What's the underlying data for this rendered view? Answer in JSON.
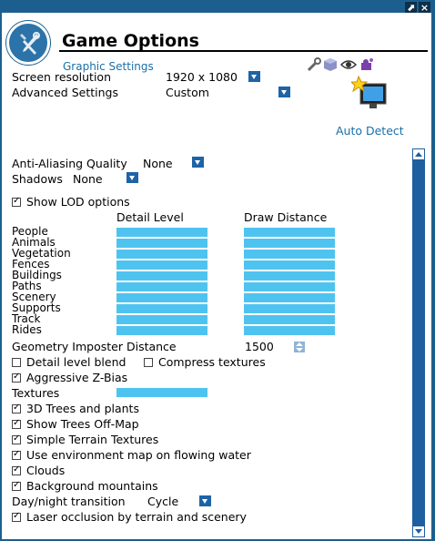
{
  "window": {
    "title": "Game Options",
    "subtitle": "Graphic Settings",
    "colors": {
      "frame": "#1c5f8f",
      "accent": "#1a6fa8",
      "slider": "#4fc3f0",
      "dropdown": "#1e63a6"
    }
  },
  "header_icons": [
    "wrench-icon",
    "cube-icon",
    "eye-icon",
    "puzzle-icon"
  ],
  "resolution": {
    "label": "Screen resolution",
    "value": "1920 x 1080"
  },
  "advanced": {
    "label": "Advanced Settings",
    "value": "Custom"
  },
  "auto_detect": {
    "label": "Auto Detect"
  },
  "antialias": {
    "label": "Anti-Aliasing Quality",
    "value": "None"
  },
  "shadows": {
    "label": "Shadows",
    "value": "None"
  },
  "lod": {
    "show_label": "Show LOD options",
    "show_checked": true,
    "detail_header": "Detail Level",
    "distance_header": "Draw Distance",
    "rows": [
      {
        "label": "People",
        "detail": 1.0,
        "distance": 1.0
      },
      {
        "label": "Animals",
        "detail": 1.0,
        "distance": 1.0
      },
      {
        "label": "Vegetation",
        "detail": 1.0,
        "distance": 1.0
      },
      {
        "label": "Fences",
        "detail": 1.0,
        "distance": 1.0
      },
      {
        "label": "Buildings",
        "detail": 1.0,
        "distance": 1.0
      },
      {
        "label": "Paths",
        "detail": 1.0,
        "distance": 1.0
      },
      {
        "label": "Scenery",
        "detail": 1.0,
        "distance": 1.0
      },
      {
        "label": "Supports",
        "detail": 1.0,
        "distance": 1.0
      },
      {
        "label": "Track",
        "detail": 1.0,
        "distance": 1.0
      },
      {
        "label": "Rides",
        "detail": 1.0,
        "distance": 1.0
      }
    ]
  },
  "imposter": {
    "label": "Geometry Imposter Distance",
    "value": "1500"
  },
  "detail_blend": {
    "label": "Detail level blend",
    "checked": false
  },
  "compress": {
    "label": "Compress textures",
    "checked": false
  },
  "zbias": {
    "label": "Aggressive Z-Bias",
    "checked": true
  },
  "textures": {
    "label": "Textures",
    "level": 1.0
  },
  "options": [
    {
      "label": "3D Trees and plants",
      "checked": true
    },
    {
      "label": "Show Trees Off-Map",
      "checked": true
    },
    {
      "label": "Simple Terrain Textures",
      "checked": true
    },
    {
      "label": "Use environment map on flowing water",
      "checked": true
    },
    {
      "label": "Clouds",
      "checked": true
    },
    {
      "label": "Background mountains",
      "checked": true
    }
  ],
  "daynight": {
    "label": "Day/night transition",
    "value": "Cycle"
  },
  "laser": {
    "label": "Laser occlusion by terrain and scenery",
    "checked": true
  }
}
